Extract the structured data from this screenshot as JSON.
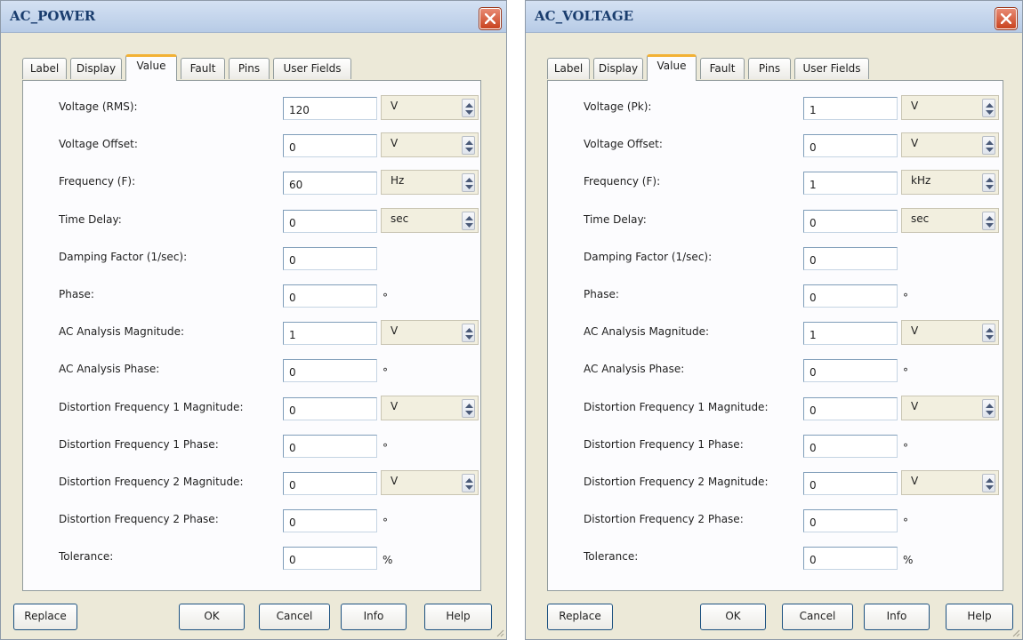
{
  "ac_power": {
    "title": "AC_POWER",
    "tabs": [
      "Label",
      "Display",
      "Value",
      "Fault",
      "Pins",
      "User Fields"
    ],
    "active_tab": "Value",
    "rows": [
      {
        "label": "Voltage (RMS):",
        "value": "120",
        "unit": "V"
      },
      {
        "label": "Voltage Offset:",
        "value": "0",
        "unit": "V"
      },
      {
        "label": "Frequency (F):",
        "value": "60",
        "unit": "Hz"
      },
      {
        "label": "Time Delay:",
        "value": "0",
        "unit": "sec"
      },
      {
        "label": "Damping Factor (1/sec):",
        "value": "0"
      },
      {
        "label": "Phase:",
        "value": "0",
        "suffix": "°"
      },
      {
        "label": "AC Analysis Magnitude:",
        "value": "1",
        "unit": "V"
      },
      {
        "label": "AC Analysis Phase:",
        "value": "0",
        "suffix": "°"
      },
      {
        "label": "Distortion Frequency 1 Magnitude:",
        "value": "0",
        "unit": "V"
      },
      {
        "label": "Distortion Frequency 1 Phase:",
        "value": "0",
        "suffix": "°"
      },
      {
        "label": "Distortion Frequency 2 Magnitude:",
        "value": "0",
        "unit": "V"
      },
      {
        "label": "Distortion Frequency 2 Phase:",
        "value": "0",
        "suffix": "°"
      },
      {
        "label": "Tolerance:",
        "value": "0",
        "suffix": "%"
      }
    ],
    "buttons": {
      "replace": "Replace",
      "ok": "OK",
      "cancel": "Cancel",
      "info": "Info",
      "help": "Help"
    }
  },
  "ac_voltage": {
    "title": "AC_VOLTAGE",
    "tabs": [
      "Label",
      "Display",
      "Value",
      "Fault",
      "Pins",
      "User Fields"
    ],
    "active_tab": "Value",
    "rows": [
      {
        "label": "Voltage (Pk):",
        "value": "1",
        "unit": "V"
      },
      {
        "label": "Voltage Offset:",
        "value": "0",
        "unit": "V"
      },
      {
        "label": "Frequency (F):",
        "value": "1",
        "unit": "kHz"
      },
      {
        "label": "Time Delay:",
        "value": "0",
        "unit": "sec"
      },
      {
        "label": "Damping Factor (1/sec):",
        "value": "0"
      },
      {
        "label": "Phase:",
        "value": "0",
        "suffix": "°"
      },
      {
        "label": "AC Analysis Magnitude:",
        "value": "1",
        "unit": "V"
      },
      {
        "label": "AC Analysis Phase:",
        "value": "0",
        "suffix": "°"
      },
      {
        "label": "Distortion Frequency 1 Magnitude:",
        "value": "0",
        "unit": "V"
      },
      {
        "label": "Distortion Frequency 1 Phase:",
        "value": "0",
        "suffix": "°"
      },
      {
        "label": "Distortion Frequency 2 Magnitude:",
        "value": "0",
        "unit": "V"
      },
      {
        "label": "Distortion Frequency 2 Phase:",
        "value": "0",
        "suffix": "°"
      },
      {
        "label": "Tolerance:",
        "value": "0",
        "suffix": "%"
      }
    ],
    "buttons": {
      "replace": "Replace",
      "ok": "OK",
      "cancel": "Cancel",
      "info": "Info",
      "help": "Help"
    }
  },
  "icons": {
    "close": "close-icon",
    "spinner": "spinner-arrows-icon",
    "grip": "resize-grip-icon"
  },
  "colors": {
    "title_text": "#1a3d6e",
    "close_button": "#c9431f",
    "active_tab_highlight": "#f2b134",
    "dialog_bg": "#ece9d8"
  }
}
